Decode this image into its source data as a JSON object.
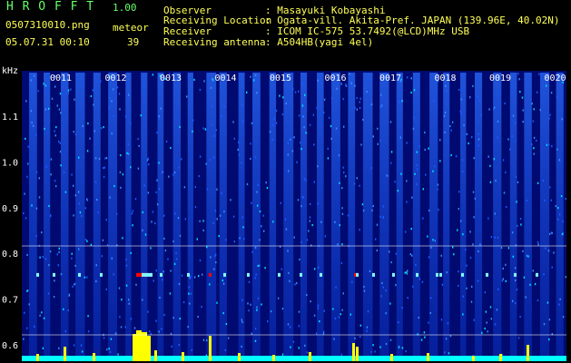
{
  "header": {
    "logo": "H R O F F T",
    "version": "1.00",
    "filename": "0507310010.png",
    "timestamp": "05.07.31 00:10",
    "count_label": "meteor",
    "count_value": "39",
    "info_rows": [
      {
        "label": "Observer",
        "value": ": Masayuki Kobayashi"
      },
      {
        "label": "Receiving Location",
        "value": ": Ogata-vill. Akita-Pref. JAPAN (139.96E, 40.02N)"
      },
      {
        "label": "Receiver",
        "value": ": ICOM IC-575 53.7492(@LCD)MHz USB"
      },
      {
        "label": "Receiving antenna",
        "value": ": A504HB(yagi 4el)"
      }
    ]
  },
  "spectrogram": {
    "unit_label": "kHz",
    "y_ticks": [
      "1.1",
      "1.0",
      "0.9",
      "0.8",
      "0.7",
      "0.6"
    ],
    "y_tick_values": [
      1.1,
      1.0,
      0.9,
      0.8,
      0.7,
      0.6
    ],
    "time_labels": [
      "0011",
      "0012",
      "0013",
      "0014",
      "0015",
      "0016",
      "0017",
      "0018",
      "0019",
      "0020"
    ],
    "colors": {
      "background": "#000080",
      "noise_low": "#0000ff",
      "noise_high": "#00ffff",
      "echo": "#ff0000",
      "level_bars": "#ffff00",
      "level_base": "#00ffff",
      "guide_line": "#ffffff"
    }
  }
}
